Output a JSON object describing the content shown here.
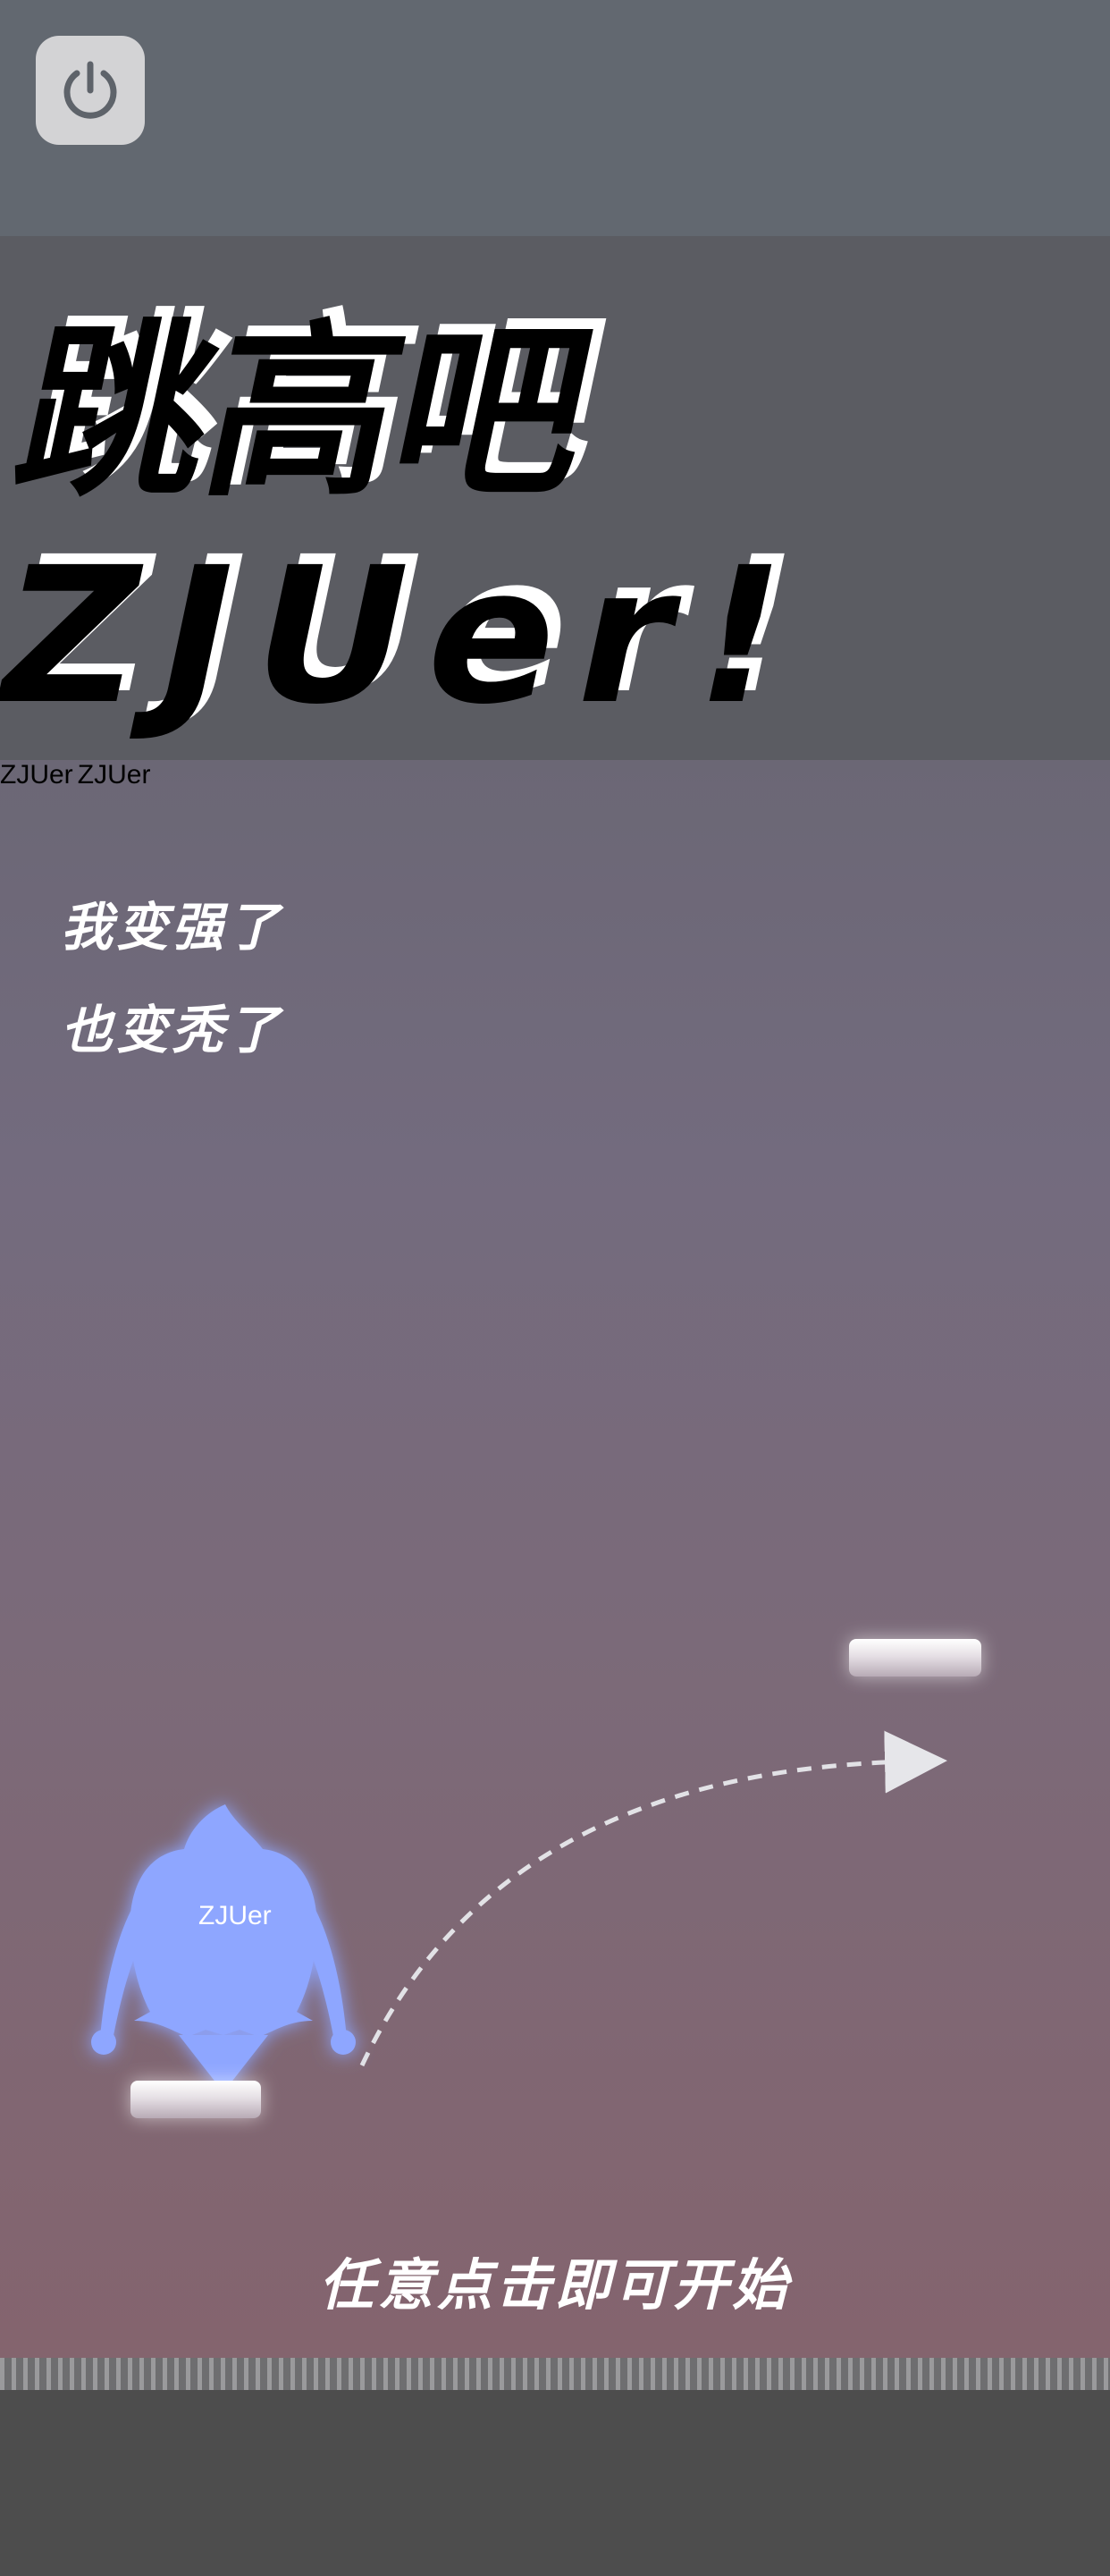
{
  "header": {
    "power_icon": "power-icon"
  },
  "title": {
    "line1": "跳高吧",
    "line2": "ZJUer!"
  },
  "tagline": {
    "line1": "我变强了",
    "line2": "也变秃了"
  },
  "characters": [
    {
      "label": "ZJUer",
      "form": "slim"
    },
    {
      "label": "ZJUer",
      "form": "wide"
    },
    {
      "label": "ZJUer",
      "form": "muscular"
    }
  ],
  "hint": {
    "icon": "hand-tap-icon",
    "arrow": "dashed-arrow"
  },
  "start_text": "任意点击即可开始",
  "colors": {
    "character": "#8ea6ff",
    "glow": "#b4c4ff",
    "text": "#ffffff",
    "title_fill": "#000000"
  }
}
